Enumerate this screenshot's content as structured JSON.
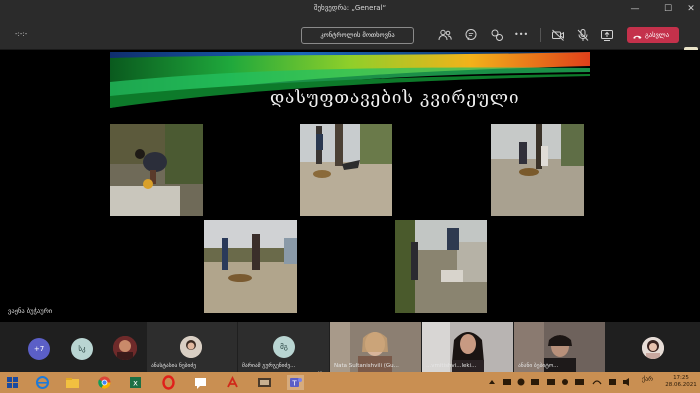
{
  "window": {
    "title": "შეხვედრა: „General“",
    "minimize": "—",
    "maximize": "☐",
    "close": "✕"
  },
  "toolbar": {
    "timer": "-:-:-",
    "control_button": "კონტროლის მოთხოვნა",
    "leave_button": "გასვლა",
    "more_label": "•••"
  },
  "slide": {
    "title": "დასუფთავების კვირეული",
    "presenter": "ვაჟნა ბუჭაური"
  },
  "participants": {
    "overflow_count": "+7",
    "avatar_initials_1": "სკ",
    "avatar_initials_2": "მგ",
    "tile_1_name": "ანასტასია ნებიძე",
    "tile_2_name": "მარიამ გურგენიძე...",
    "tile_3_name": "Nata Sultanishvili (Gu...",
    "tile_4_name": "...vmitishvi...leki...",
    "tile_5_name": "ანანი ბებიტო..."
  },
  "taskbar": {
    "language": "ქარ",
    "time": "17:25",
    "date": "28.06.2021"
  },
  "colors": {
    "leave": "#c4314b",
    "taskbar": "#c98f52",
    "avatar_purple": "#5b5fc7",
    "avatar_teal": "#b9d5d2"
  }
}
